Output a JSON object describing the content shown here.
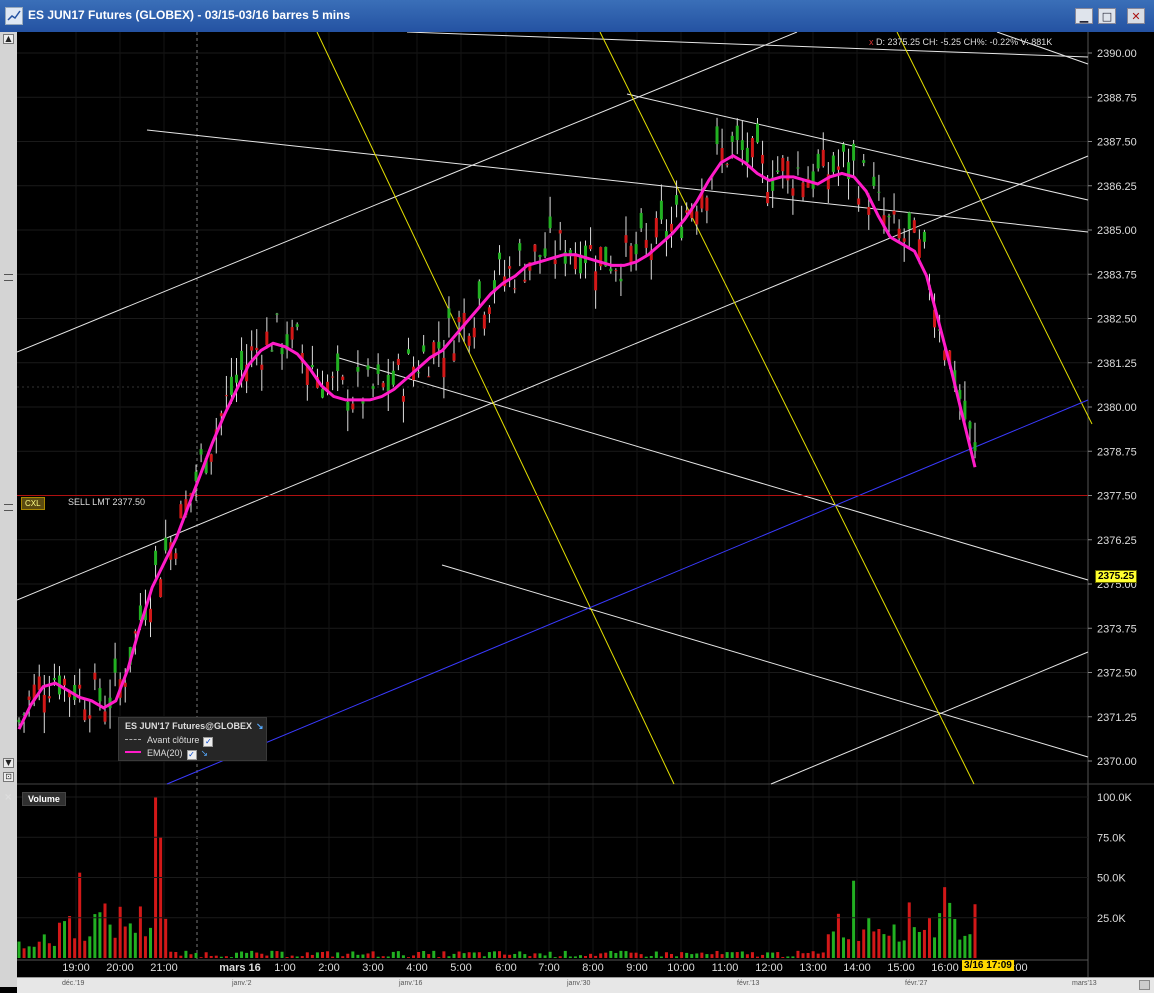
{
  "window": {
    "title": "ES JUN17 Futures (GLOBEX) - 03/15-03/16 barres 5 mins",
    "minimize_glyph": "▁",
    "maximize_glyph": "□",
    "close_glyph": "✕"
  },
  "info_line": {
    "marker": "x",
    "text": "D: 2375.25  CH: -5.25  CH%: -0.22%  V: 881K"
  },
  "price_axis": {
    "ticks": [
      "2390.00",
      "2388.75",
      "2387.50",
      "2386.25",
      "2385.00",
      "2383.75",
      "2382.50",
      "2381.25",
      "2380.00",
      "2378.75",
      "2377.50",
      "2376.25",
      "2375.00",
      "2373.75",
      "2372.50",
      "2371.25",
      "2370.00"
    ],
    "last_price_label": "2375.25"
  },
  "volume_axis": {
    "ticks": [
      "100.0K",
      "75.0K",
      "50.0K",
      "25.0K"
    ]
  },
  "time_axis": {
    "labels": [
      "19:00",
      "20:00",
      "21:00",
      "mars 16",
      "1:00",
      "2:00",
      "3:00",
      "4:00",
      "5:00",
      "6:00",
      "7:00",
      "8:00",
      "9:00",
      "10:00",
      "11:00",
      "12:00",
      "13:00",
      "14:00",
      "15:00",
      "16:00",
      ":00"
    ],
    "current_time_tag": "3/16 17:09"
  },
  "order": {
    "cxl_label": "CXL",
    "text": "SELL LMT 2377.50",
    "price": 2377.5
  },
  "legend": {
    "title": "ES JUN'17 Futures@GLOBEX",
    "row1": "Avant clôture",
    "row2": "EMA(20)",
    "check_glyph": "✓",
    "gear_glyph": "↘"
  },
  "volume_panel": {
    "label": "Volume",
    "close_glyph": "×"
  },
  "navigator": {
    "labels": [
      "déc.'19",
      "janv.'2",
      "janv.'16",
      "janv.'30",
      "févr.'13",
      "févr.'27",
      "mars'13"
    ]
  },
  "colors": {
    "background": "#000000",
    "up_bar": "#22b022",
    "down_bar": "#d21818",
    "ema": "#ff1bc8",
    "trend_white": "#e6e6e6",
    "trend_yellow": "#e4e000",
    "trend_blue": "#3a3aff",
    "order_line": "#b01010",
    "last_price_tag": "#ffff30"
  },
  "chart_data": {
    "type": "candlestick",
    "y_range": [
      2369.5,
      2390.6
    ],
    "series": [
      {
        "name": "EMA(20)",
        "values": [
          2370.9,
          2371.6,
          2372.1,
          2372.2,
          2372.0,
          2371.8,
          2371.7,
          2371.5,
          2371.7,
          2372.6,
          2373.8,
          2374.9,
          2375.6,
          2376.3,
          2377.2,
          2378.1,
          2379.0,
          2379.8,
          2380.5,
          2381.2,
          2381.6,
          2381.8,
          2381.7,
          2381.5,
          2381.1,
          2380.6,
          2380.3,
          2380.2,
          2380.2,
          2380.2,
          2380.3,
          2380.5,
          2380.8,
          2381.1,
          2381.4,
          2381.6,
          2382.0,
          2382.4,
          2382.8,
          2383.2,
          2383.5,
          2383.7,
          2384.0,
          2384.1,
          2384.2,
          2384.3,
          2384.3,
          2384.2,
          2384.1,
          2384.0,
          2384.0,
          2384.1,
          2384.3,
          2384.6,
          2384.9,
          2385.3,
          2385.8,
          2386.4,
          2386.9,
          2387.1,
          2386.9,
          2386.6,
          2386.4,
          2386.5,
          2386.5,
          2386.4,
          2386.3,
          2386.5,
          2386.6,
          2386.5,
          2386.1,
          2385.4,
          2384.8,
          2384.6,
          2384.4,
          2383.7,
          2382.4,
          2381.1,
          2379.7,
          2378.3
        ]
      },
      {
        "name": "Avant clôture",
        "values": []
      }
    ],
    "volume_range": [
      0,
      100000
    ]
  }
}
